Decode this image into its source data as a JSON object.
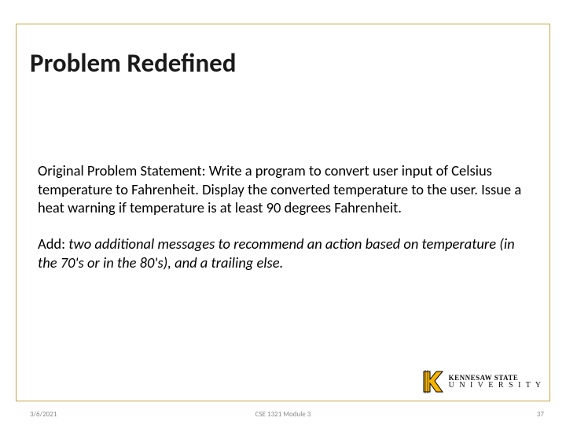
{
  "title": "Problem Redefined",
  "paragraphs": {
    "p1": "Original Problem Statement: Write a program to convert user input of Celsius temperature to Fahrenheit.  Display the converted temperature to the user.  Issue a heat warning if temperature is at least 90 degrees Fahrenheit.",
    "p2_label": "Add: ",
    "p2_text": "two additional messages to recommend an action based on temperature (in the 70's or in the 80's), and a trailing else."
  },
  "footer": {
    "date": "3/6/2021",
    "center": "CSE 1321 Module 3",
    "page": "37"
  },
  "logo": {
    "line1": "KENNESAW STATE",
    "line2a": "U N I V E R S I T Y"
  },
  "colors": {
    "accent": "#c9a542"
  }
}
